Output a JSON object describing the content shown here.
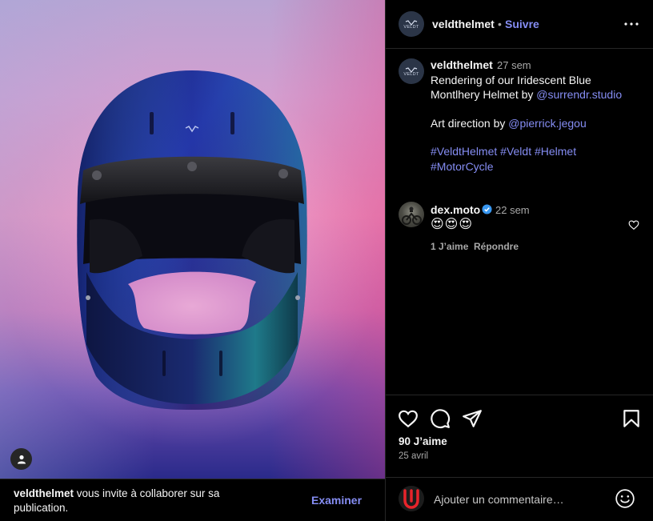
{
  "post": {
    "username": "veldthelmet",
    "follow_separator": "•",
    "follow_label": "Suivre",
    "avatar_logo_text": "VELDT"
  },
  "caption": {
    "username": "veldthelmet",
    "time": "27 sem",
    "line1": "Rendering of our Iridescent Blue",
    "line2_text": "Montlhery Helmet by ",
    "line2_mention": "@surrendr.studio",
    "line3_text": "Art direction by ",
    "line3_mention": "@pierrick.jegou",
    "hashtags_line1": "#VeldtHelmet #Veldt #Helmet",
    "hashtags_line2": "#MotorCycle"
  },
  "comment": {
    "username": "dex.moto",
    "time": "22 sem",
    "emoji": "😍😍😍",
    "likes": "1 J’aime",
    "reply_label": "Répondre"
  },
  "actions": {
    "likes": "90 J’aime",
    "date": "25 avril"
  },
  "add_comment": {
    "placeholder": "Ajouter un commentaire…"
  },
  "collab": {
    "username": "veldthelmet",
    "text": " vous invite à collaborer sur sa publication.",
    "button": "Examiner"
  },
  "icons": {
    "more": "more-icon",
    "heart": "heart-icon",
    "comment": "comment-icon",
    "share": "share-icon",
    "bookmark": "bookmark-icon",
    "smiley": "smiley-icon",
    "user_tag": "user-tag-icon",
    "verified": "verified-badge-icon"
  },
  "colors": {
    "accent": "#858df3",
    "verified": "#3897f0",
    "secondary_text": "#a8a8a8"
  }
}
